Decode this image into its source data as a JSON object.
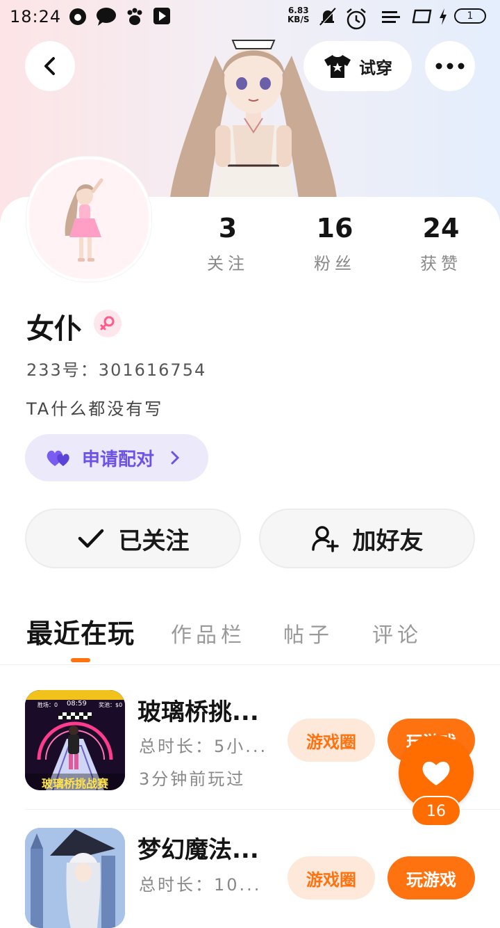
{
  "status_bar": {
    "time": "18:24",
    "net_speed_value": "6.83",
    "net_speed_unit": "KB/S",
    "battery": "1"
  },
  "header": {
    "try_on_label": "试穿"
  },
  "profile": {
    "name": "女仆",
    "id_line": "233号：301616754",
    "bio": "TA什么都没有写",
    "pair_label": "申请配对",
    "stats": [
      {
        "value": "3",
        "label": "关注"
      },
      {
        "value": "16",
        "label": "粉丝"
      },
      {
        "value": "24",
        "label": "获赞"
      }
    ],
    "followed_label": "已关注",
    "add_friend_label": "加好友"
  },
  "tabs": [
    {
      "label": "最近在玩"
    },
    {
      "label": "作品栏"
    },
    {
      "label": "帖子"
    },
    {
      "label": "评论"
    }
  ],
  "games": [
    {
      "title": "玻璃桥挑...",
      "duration": "总时长：5小...",
      "last_played": "3分钟前玩过",
      "thumb_caption": "玻璃桥挑战赛",
      "thumb_timer": "08:59",
      "thumb_left": "胜场：0",
      "thumb_right": "奖池：$0",
      "circle_label": "游戏圈",
      "play_label": "玩游戏"
    },
    {
      "title": "梦幻魔法...",
      "duration": "总时长：10...",
      "circle_label": "游戏圈",
      "play_label": "玩游戏"
    }
  ],
  "float_like": {
    "count": "16"
  },
  "colors": {
    "accent": "#ff7210",
    "purple": "#6c52e6"
  }
}
